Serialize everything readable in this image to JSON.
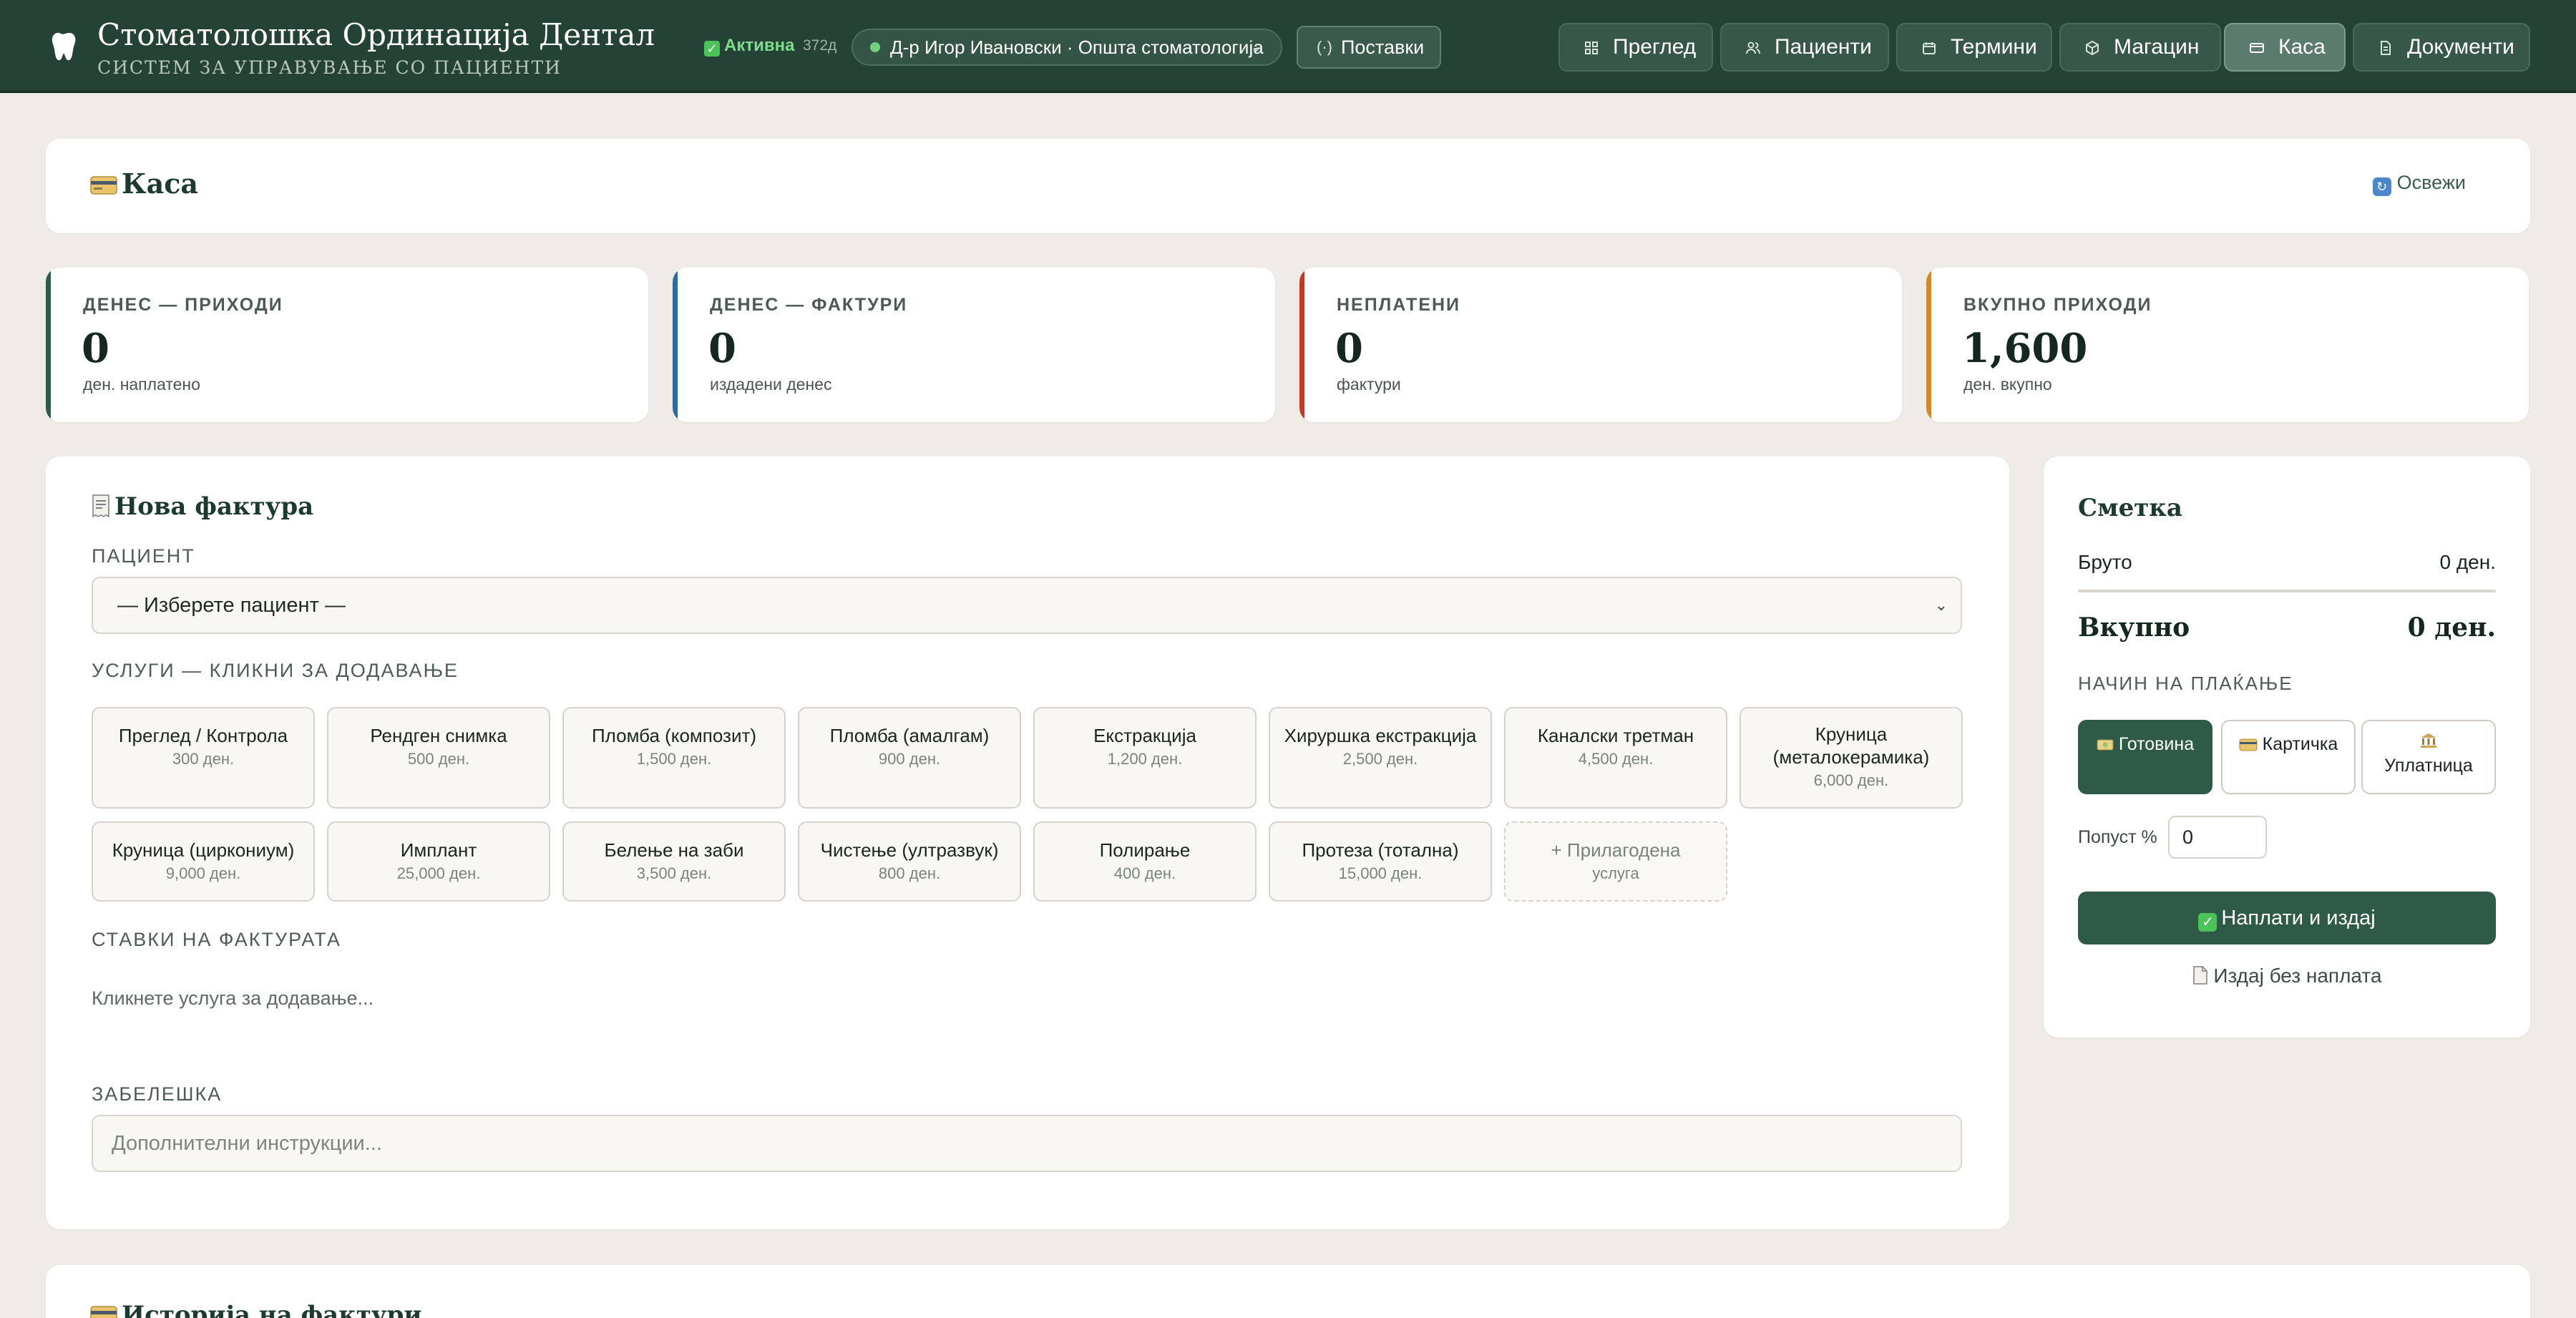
{
  "app": {
    "title": "Стоматолошка Ординација Дентал",
    "subtitle": "СИСТЕМ ЗА УПРАВУВАЊЕ СО ПАЦИЕНТИ",
    "status_label": "Активна",
    "status_days": "372д",
    "doctor": "Д-р Игор Ивановски · Општа стоматологија",
    "settings_label": "Поставки"
  },
  "nav": {
    "tabs": [
      {
        "label": "Преглед",
        "icon": "grid-icon"
      },
      {
        "label": "Пациенти",
        "icon": "users-icon"
      },
      {
        "label": "Термини",
        "icon": "calendar-icon"
      },
      {
        "label": "Магацин",
        "icon": "box-icon"
      },
      {
        "label": "Каса",
        "icon": "card-icon",
        "active": true
      },
      {
        "label": "Документи",
        "icon": "document-icon"
      }
    ]
  },
  "page": {
    "title": "Каса",
    "refresh_label": "Освежи"
  },
  "stats": [
    {
      "label": "ДЕНЕС — ПРИХОДИ",
      "value": "0",
      "sub": "ден. наплатено",
      "color": "#2e5a47"
    },
    {
      "label": "ДЕНЕС — ФАКТУРИ",
      "value": "0",
      "sub": "издадени денес",
      "color": "#2f6b9a"
    },
    {
      "label": "НЕПЛАТЕНИ",
      "value": "0",
      "sub": "фактури",
      "color": "#c0392b"
    },
    {
      "label": "ВКУПНО ПРИХОДИ",
      "value": "1,600",
      "sub": "ден. вкупно",
      "color": "#d08a2a"
    }
  ],
  "invoice": {
    "title": "Нова фактура",
    "patient_label": "ПАЦИЕНТ",
    "patient_placeholder": "— Изберете пациент —",
    "services_label": "УСЛУГИ — КЛИКНИ ЗА ДОДАВАЊЕ",
    "services": [
      {
        "name": "Преглед / Контрола",
        "price": "300 ден."
      },
      {
        "name": "Рендген снимка",
        "price": "500 ден."
      },
      {
        "name": "Пломба (композит)",
        "price": "1,500 ден."
      },
      {
        "name": "Пломба (амалгам)",
        "price": "900 ден."
      },
      {
        "name": "Екстракција",
        "price": "1,200 ден."
      },
      {
        "name": "Хируршка екстракција",
        "price": "2,500 ден."
      },
      {
        "name": "Каналски третман",
        "price": "4,500 ден."
      },
      {
        "name": "Круница (металокерамика)",
        "price": "6,000 ден."
      },
      {
        "name": "Круница (циркониум)",
        "price": "9,000 ден."
      },
      {
        "name": "Имплант",
        "price": "25,000 ден."
      },
      {
        "name": "Белење на заби",
        "price": "3,500 ден."
      },
      {
        "name": "Чистење (ултразвук)",
        "price": "800 ден."
      },
      {
        "name": "Полирање",
        "price": "400 ден."
      },
      {
        "name": "Протеза (тотална)",
        "price": "15,000 ден."
      }
    ],
    "custom_service": {
      "line1": "+ Прилагодена",
      "line2": "услуга"
    },
    "items_label": "СТАВКИ НА ФАКТУРАТА",
    "items_hint": "Кликнете услуга за додавање...",
    "note_label": "ЗАБЕЛЕШКА",
    "note_placeholder": "Дополнителни инструкции..."
  },
  "bill": {
    "title": "Сметка",
    "gross_label": "Бруто",
    "gross_value": "0 ден.",
    "total_label": "Вкупно",
    "total_value": "0 ден.",
    "payment_label": "НАЧИН НА ПЛАЌАЊЕ",
    "methods": [
      {
        "label": "Готовина",
        "selected": true
      },
      {
        "label": "Картичка",
        "selected": false
      },
      {
        "label": "Уплатница",
        "selected": false
      }
    ],
    "discount_label": "Попуст %",
    "discount_value": "0",
    "pay_button": "Наплати и издај",
    "no_pay_button": "Издај без наплата"
  },
  "history": {
    "title": "Историја на фактури"
  }
}
